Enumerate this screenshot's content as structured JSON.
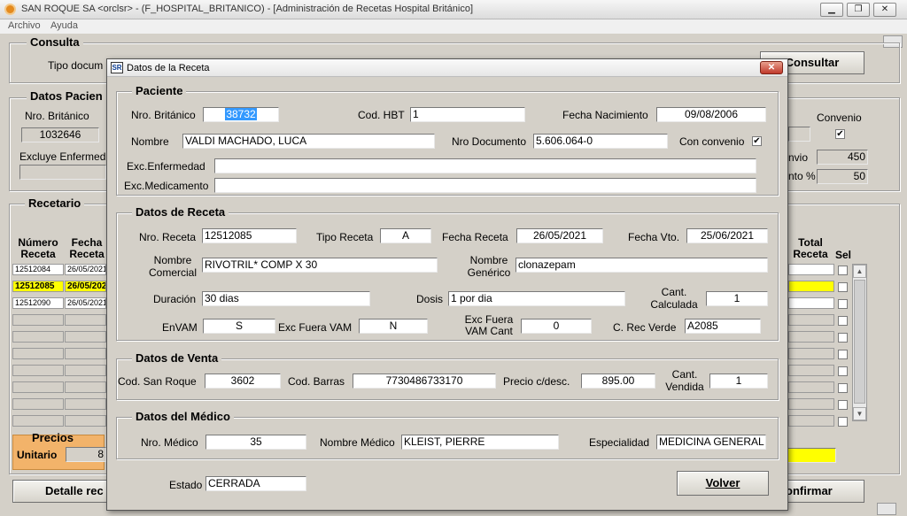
{
  "window": {
    "title": "SAN ROQUE SA <orclsr> - (F_HOSPITAL_BRITANICO) - [Administración de Recetas Hospital Británico]",
    "min": "▁",
    "restore": "❐",
    "close": "✕"
  },
  "menu": [
    "Archivo",
    "Ayuda"
  ],
  "consulta": {
    "title": "Consulta",
    "tipo_doc_label": "Tipo docum",
    "consultar_button": "Consultar"
  },
  "datos_paciente": {
    "title": "Datos Pacien",
    "nro_britanico_label": "Nro. Británico",
    "nro_britanico_value": "1032646",
    "excluye_label": "Excluye Enfermed",
    "convenio_label": "Convenio",
    "convenio_checked": "✔",
    "envio_label": "nvio",
    "envio_value": "450",
    "nto_label": "nto %",
    "nto_value": "50"
  },
  "recetario": {
    "title": "Recetario",
    "col_numero": "Número Receta",
    "col_fecha": "Fecha Receta",
    "col_total": "Total Receta",
    "col_sel": "Sel",
    "rows": [
      {
        "numero": "12512084",
        "fecha": "26/05/2021"
      },
      {
        "numero": "12512085",
        "fecha": "26/05/2021"
      },
      {
        "numero": "12512090",
        "fecha": "26/05/2021"
      }
    ],
    "scroll_up": "▲",
    "scroll_down": "▼"
  },
  "precios": {
    "title": "Precios",
    "unitario_label": "Unitario",
    "unitario_value": "8"
  },
  "bottom": {
    "detalle_button": "Detalle rec",
    "confirmar_button": "onfirmar"
  },
  "dialog": {
    "title": "Datos de la Receta",
    "close": "✕",
    "paciente": {
      "title": "Paciente",
      "nro_britanico_label": "Nro. Británico",
      "nro_britanico": "38732",
      "cod_hbt_label": "Cod. HBT",
      "cod_hbt": "1",
      "fecha_nac_label": "Fecha Nacimiento",
      "fecha_nac": "09/08/2006",
      "nombre_label": "Nombre",
      "nombre": "VALDI MACHADO, LUCA",
      "nro_doc_label": "Nro Documento",
      "nro_doc": "5.606.064-0",
      "con_convenio_label": "Con convenio",
      "con_convenio_checked": "✔",
      "exc_enf_label": "Exc.Enfermedad",
      "exc_enf": "",
      "exc_med_label": "Exc.Medicamento",
      "exc_med": ""
    },
    "receta": {
      "title": "Datos de Receta",
      "nro_receta_label": "Nro. Receta",
      "nro_receta": "12512085",
      "tipo_label": "Tipo Receta",
      "tipo": "A",
      "fecha_label": "Fecha Receta",
      "fecha": "26/05/2021",
      "fecha_vto_label": "Fecha Vto.",
      "fecha_vto": "25/06/2021",
      "nombre_comercial_label_1": "Nombre",
      "nombre_comercial_label_2": "Comercial",
      "nombre_comercial": "RIVOTRIL* COMP X 30",
      "nombre_generico_label_1": "Nombre",
      "nombre_generico_label_2": "Genérico",
      "nombre_generico": "clonazepam",
      "duracion_label": "Duración",
      "duracion": "30 dias",
      "dosis_label": "Dosis",
      "dosis": "1 por dia",
      "cant_calc_label_1": "Cant.",
      "cant_calc_label_2": "Calculada",
      "cant_calc": "1",
      "envam_label": "EnVAM",
      "envam": "S",
      "exc_fuera_vam_label": "Exc Fuera VAM",
      "exc_fuera_vam": "N",
      "exc_fuera_cant_label_1": "Exc Fuera",
      "exc_fuera_cant_label_2": "VAM Cant",
      "exc_fuera_cant": "0",
      "c_rec_verde_label": "C. Rec Verde",
      "c_rec_verde": "A2085"
    },
    "venta": {
      "title": "Datos de Venta",
      "cod_sr_label": "Cod. San Roque",
      "cod_sr": "3602",
      "cod_barras_label": "Cod. Barras",
      "cod_barras": "7730486733170",
      "precio_label": "Precio c/desc.",
      "precio": "895.00",
      "cant_vend_label_1": "Cant.",
      "cant_vend_label_2": "Vendida",
      "cant_vend": "1"
    },
    "medico": {
      "title": "Datos del Médico",
      "nro_medico_label": "Nro. Médico",
      "nro_medico": "35",
      "nombre_label": "Nombre Médico",
      "nombre": "KLEIST, PIERRE",
      "especialidad_label": "Especialidad",
      "especialidad": "MEDICINA GENERAL"
    },
    "estado_label": "Estado",
    "estado": "CERRADA",
    "volver_button": "Volver"
  }
}
